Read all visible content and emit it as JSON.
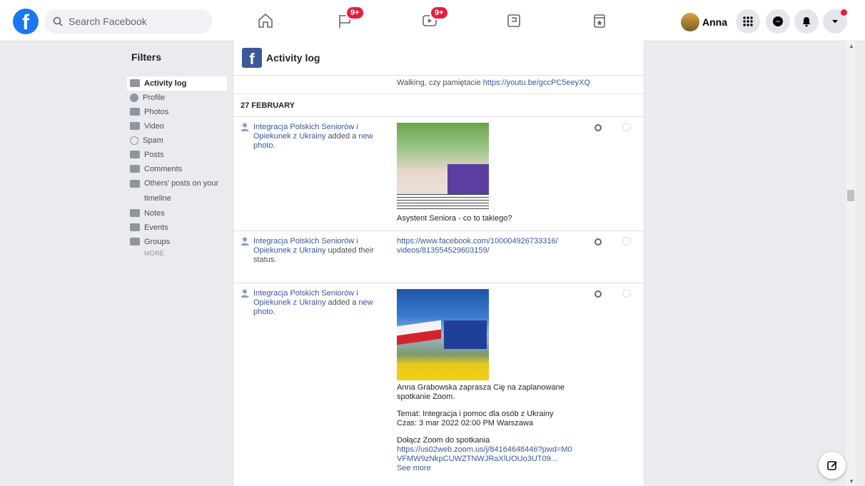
{
  "topbar": {
    "search_placeholder": "Search Facebook",
    "friends_badge": "9+",
    "watch_badge": "9+",
    "profile_name": "Anna"
  },
  "sidebar": {
    "title": "Filters",
    "items": [
      {
        "label": "Activity log",
        "icon": "facebook-icon"
      },
      {
        "label": "Profile",
        "icon": "info-icon"
      },
      {
        "label": "Photos",
        "icon": "photos-icon"
      },
      {
        "label": "Video",
        "icon": "video-icon"
      },
      {
        "label": "Spam",
        "icon": "spam-icon"
      },
      {
        "label": "Posts",
        "icon": "person-icon"
      },
      {
        "label": "Comments",
        "icon": "comment-icon"
      },
      {
        "label": "Others' posts on your timeline",
        "icon": "comment-icon"
      },
      {
        "label": "Notes",
        "icon": "notes-icon"
      },
      {
        "label": "Events",
        "icon": "events-icon"
      },
      {
        "label": "Groups",
        "icon": "groups-icon"
      }
    ],
    "more": "MORE"
  },
  "main": {
    "header_title": "Activity log",
    "continued_text": "Walking, czy pamiętacie ",
    "continued_link": "https://youtu.be/gccPC5eeyXQ",
    "date": "27 FEBRUARY",
    "entries": [
      {
        "actor": "Integracja Polskich Seniorów i Opiekunek z Ukrainy",
        "action": " added a ",
        "object": "new photo",
        "caption": "Asystent Seniora - co to takiego?"
      },
      {
        "actor": "Integracja Polskich Seniorów i Opiekunek z Ukrainy",
        "action": " updated their status",
        "link": "https://www.facebook.com/100004926733316/videos/813554529603159/"
      },
      {
        "actor": "Integracja Polskich Seniorów i Opiekunek z Ukrainy",
        "action": " added a ",
        "object": "new photo",
        "lines": [
          "Anna Grabowska zaprasza Cię na zaplanowane spotkanie Zoom.",
          "Temat: Integracja i pomoc dla osób z Ukrainy",
          "Czas: 3 mar 2022 02:00 PM Warszawa",
          "Dołącz Zoom do spotkania"
        ],
        "zoom_link": "https://us02web.zoom.us/j/84164648446?pwd=M0VFMW9zNkpCUWZTNWJRaXlUOUo3UT09...",
        "see_more": "See more"
      }
    ]
  },
  "colors": {
    "brand": "#1877f2",
    "badge": "#e41e3f",
    "link": "#385898"
  }
}
